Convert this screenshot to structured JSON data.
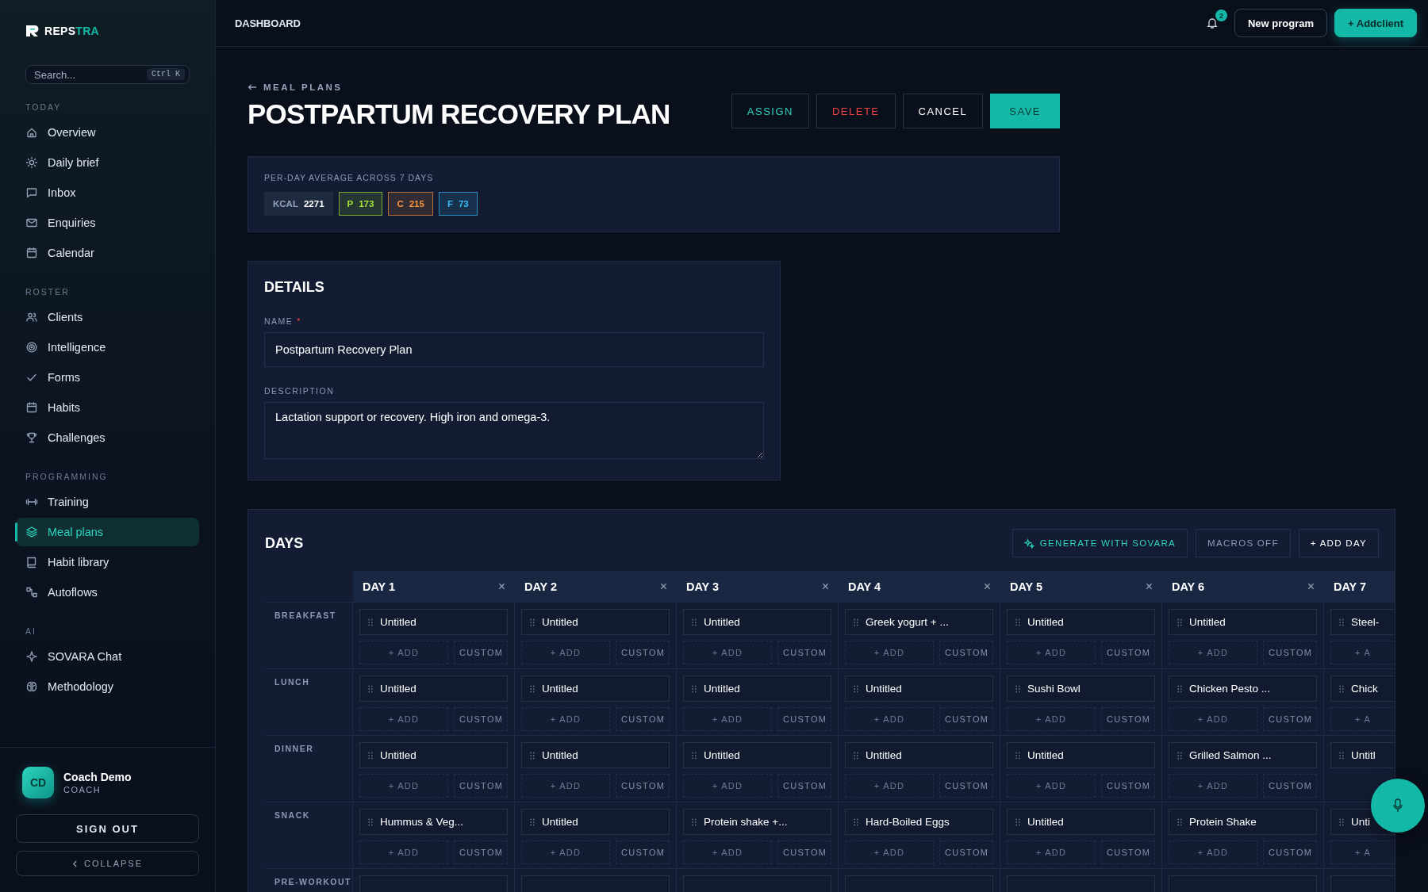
{
  "sidebar": {
    "logo": {
      "text": "REPS",
      "accent": "TRA"
    },
    "search": {
      "placeholder": "Search...",
      "shortcut": "Ctrl K"
    },
    "sections": [
      {
        "title": "TODAY",
        "items": [
          {
            "label": "Overview",
            "selected": false
          },
          {
            "label": "Daily brief",
            "selected": false
          },
          {
            "label": "Inbox",
            "selected": false
          },
          {
            "label": "Enquiries",
            "selected": false
          },
          {
            "label": "Calendar",
            "selected": false
          }
        ]
      },
      {
        "title": "ROSTER",
        "items": [
          {
            "label": "Clients",
            "selected": false
          },
          {
            "label": "Intelligence",
            "selected": false
          },
          {
            "label": "Forms",
            "selected": false
          },
          {
            "label": "Habits",
            "selected": false
          },
          {
            "label": "Challenges",
            "selected": false
          }
        ]
      },
      {
        "title": "PROGRAMMING",
        "items": [
          {
            "label": "Training",
            "selected": false
          },
          {
            "label": "Meal plans",
            "selected": true
          },
          {
            "label": "Habit library",
            "selected": false
          },
          {
            "label": "Autoflows",
            "selected": false
          }
        ]
      },
      {
        "title": "AI",
        "items": [
          {
            "label": "SOVARA Chat",
            "selected": false
          },
          {
            "label": "Methodology",
            "selected": false
          }
        ]
      }
    ],
    "user": {
      "initials": "CD",
      "name": "Coach Demo",
      "role": "COACH"
    },
    "sign_out": "SIGN OUT",
    "collapse": "COLLAPSE"
  },
  "header": {
    "breadcrumb": "DASHBOARD",
    "notifications": "2",
    "buttons": [
      {
        "label": "New program",
        "kind": "outline"
      },
      {
        "label": "+ Addclient",
        "kind": "primary"
      }
    ]
  },
  "back_link": "MEAL PLANS",
  "title": "POSTPARTUM RECOVERY PLAN",
  "actions": [
    {
      "label": "ASSIGN",
      "kind": "accent"
    },
    {
      "label": "DELETE",
      "kind": "danger"
    },
    {
      "label": "CANCEL",
      "kind": "default"
    },
    {
      "label": "SAVE",
      "kind": "primary"
    }
  ],
  "averages": {
    "label": "PER-DAY AVERAGE ACROSS 7 DAYS",
    "chips": [
      {
        "kind": "kcal",
        "label": "KCAL",
        "value": "2271",
        "color": "#94a3b8"
      },
      {
        "kind": "macro",
        "label": "P",
        "value": "173",
        "color": "#a3e635"
      },
      {
        "kind": "macro",
        "label": "C",
        "value": "215",
        "color": "#fb923c"
      },
      {
        "kind": "macro",
        "label": "F",
        "value": "73",
        "color": "#38bdf8"
      }
    ]
  },
  "details": {
    "title": "DETAILS",
    "name_label": "NAME",
    "required_mark": "*",
    "name_value": "Postpartum Recovery Plan",
    "description_label": "DESCRIPTION",
    "description_value": "Lactation support or recovery. High iron and omega-3."
  },
  "days_section": {
    "title": "DAYS",
    "tools": [
      {
        "label": "GENERATE WITH SOVARA",
        "kind": "accent"
      },
      {
        "label": "MACROS OFF",
        "kind": "muted"
      },
      {
        "label": "+ ADD DAY",
        "kind": "default"
      }
    ],
    "meal_types": [
      "BREAKFAST",
      "LUNCH",
      "DINNER",
      "SNACK",
      "PRE-WORKOUT"
    ],
    "days": [
      {
        "label": "DAY 1",
        "close": "×",
        "cells": [
          {
            "item": "Untitled",
            "add": "+ ADD",
            "custom": "CUSTOM"
          },
          {
            "item": "Untitled",
            "add": "+ ADD",
            "custom": "CUSTOM"
          },
          {
            "item": "Untitled",
            "add": "+ ADD",
            "custom": "CUSTOM"
          },
          {
            "item": "Hummus & Veg...",
            "add": "+ ADD",
            "custom": "CUSTOM"
          }
        ]
      },
      {
        "label": "DAY 2",
        "close": "×",
        "cells": [
          {
            "item": "Untitled",
            "add": "+ ADD",
            "custom": "CUSTOM"
          },
          {
            "item": "Untitled",
            "add": "+ ADD",
            "custom": "CUSTOM"
          },
          {
            "item": "Untitled",
            "add": "+ ADD",
            "custom": "CUSTOM"
          },
          {
            "item": "Untitled",
            "add": "+ ADD",
            "custom": "CUSTOM"
          }
        ]
      },
      {
        "label": "DAY 3",
        "close": "×",
        "cells": [
          {
            "item": "Untitled",
            "add": "+ ADD",
            "custom": "CUSTOM"
          },
          {
            "item": "Untitled",
            "add": "+ ADD",
            "custom": "CUSTOM"
          },
          {
            "item": "Untitled",
            "add": "+ ADD",
            "custom": "CUSTOM"
          },
          {
            "item": "Protein shake +...",
            "add": "+ ADD",
            "custom": "CUSTOM"
          }
        ]
      },
      {
        "label": "DAY 4",
        "close": "×",
        "cells": [
          {
            "item": "Greek yogurt + ...",
            "add": "+ ADD",
            "custom": "CUSTOM"
          },
          {
            "item": "Untitled",
            "add": "+ ADD",
            "custom": "CUSTOM"
          },
          {
            "item": "Untitled",
            "add": "+ ADD",
            "custom": "CUSTOM"
          },
          {
            "item": "Hard-Boiled Eggs",
            "add": "+ ADD",
            "custom": "CUSTOM"
          }
        ]
      },
      {
        "label": "DAY 5",
        "close": "×",
        "cells": [
          {
            "item": "Untitled",
            "add": "+ ADD",
            "custom": "CUSTOM"
          },
          {
            "item": "Sushi Bowl",
            "add": "+ ADD",
            "custom": "CUSTOM"
          },
          {
            "item": "Untitled",
            "add": "+ ADD",
            "custom": "CUSTOM"
          },
          {
            "item": "Untitled",
            "add": "+ ADD",
            "custom": "CUSTOM"
          }
        ]
      },
      {
        "label": "DAY 6",
        "close": "×",
        "cells": [
          {
            "item": "Untitled",
            "add": "+ ADD",
            "custom": "CUSTOM"
          },
          {
            "item": "Chicken Pesto ...",
            "add": "+ ADD",
            "custom": "CUSTOM"
          },
          {
            "item": "Grilled Salmon ...",
            "add": "+ ADD",
            "custom": "CUSTOM"
          },
          {
            "item": "Protein Shake",
            "add": "+ ADD",
            "custom": "CUSTOM"
          }
        ]
      },
      {
        "label": "DAY 7",
        "cells": [
          {
            "item": "Steel-",
            "add": "+ A"
          },
          {
            "item": "Chick",
            "add": "+ A"
          },
          {
            "item": "Untitl"
          },
          {
            "item": "Unti",
            "add": "+ A"
          }
        ]
      }
    ]
  }
}
